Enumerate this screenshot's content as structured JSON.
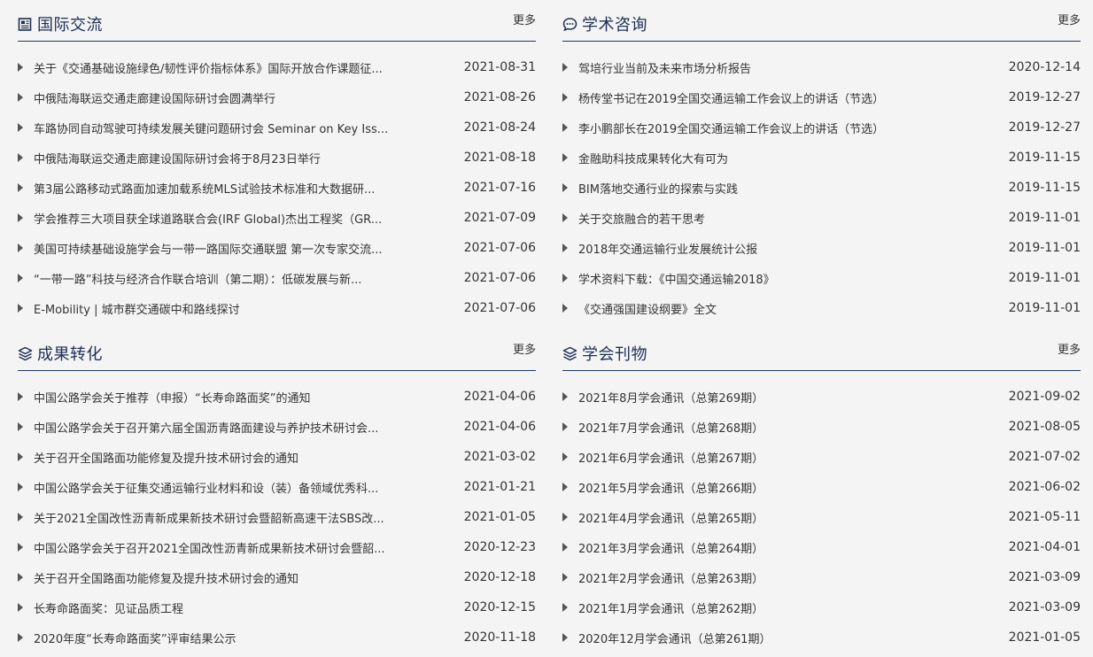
{
  "colors": {
    "accent": "#1e2f55",
    "rule": "#1f3b63",
    "background": "#f4f4f4",
    "text": "#333333"
  },
  "panels": [
    {
      "id": "international",
      "icon": "newspaper-icon",
      "title": "国际交流",
      "more": "更多",
      "items": [
        {
          "title": "关于《交通基础设施绿色/韧性评价指标体系》国际开放合作课题征...",
          "date": "2021-08-31"
        },
        {
          "title": "中俄陆海联运交通走廊建设国际研讨会圆满举行",
          "date": "2021-08-26"
        },
        {
          "title": "车路协同自动驾驶可持续发展关键问题研讨会 Seminar on Key Iss...",
          "date": "2021-08-24"
        },
        {
          "title": "中俄陆海联运交通走廊建设国际研讨会将于8月23日举行",
          "date": "2021-08-18"
        },
        {
          "title": "第3届公路移动式路面加速加载系统MLS试验技术标准和大数据研...",
          "date": "2021-07-16"
        },
        {
          "title": "学会推荐三大项目获全球道路联合会(IRF Global)杰出工程奖（GR...",
          "date": "2021-07-09"
        },
        {
          "title": "美国可持续基础设施学会与一带一路国际交通联盟 第一次专家交流...",
          "date": "2021-07-06"
        },
        {
          "title": "“一带一路”科技与经济合作联合培训（第二期）：低碳发展与新...",
          "date": "2021-07-06"
        },
        {
          "title": "E-Mobility | 城市群交通碳中和路线探讨",
          "date": "2021-07-06"
        }
      ]
    },
    {
      "id": "consulting",
      "icon": "chat-bubble-icon",
      "title": "学术咨询",
      "more": "更多",
      "items": [
        {
          "title": "驾培行业当前及未来市场分析报告",
          "date": "2020-12-14"
        },
        {
          "title": "杨传堂书记在2019全国交通运输工作会议上的讲话（节选）",
          "date": "2019-12-27"
        },
        {
          "title": "李小鹏部长在2019全国交通运输工作会议上的讲话（节选）",
          "date": "2019-12-27"
        },
        {
          "title": "金融助科技成果转化大有可为",
          "date": "2019-11-15"
        },
        {
          "title": "BIM落地交通行业的探索与实践",
          "date": "2019-11-15"
        },
        {
          "title": "关于交旅融合的若干思考",
          "date": "2019-11-01"
        },
        {
          "title": "2018年交通运输行业发展统计公报",
          "date": "2019-11-01"
        },
        {
          "title": "学术资料下载：《中国交通运输2018》",
          "date": "2019-11-01"
        },
        {
          "title": "《交通强国建设纲要》全文",
          "date": "2019-11-01"
        }
      ]
    },
    {
      "id": "achievements",
      "icon": "layers-icon",
      "title": "成果转化",
      "more": "更多",
      "items": [
        {
          "title": "中国公路学会关于推荐（申报）“长寿命路面奖”的通知",
          "date": "2021-04-06"
        },
        {
          "title": "中国公路学会关于召开第六届全国沥青路面建设与养护技术研讨会...",
          "date": "2021-04-06"
        },
        {
          "title": "关于召开全国路面功能修复及提升技术研讨会的通知",
          "date": "2021-03-02"
        },
        {
          "title": "中国公路学会关于征集交通运输行业材料和设（装）备领域优秀科...",
          "date": "2021-01-21"
        },
        {
          "title": "关于2021全国改性沥青新成果新技术研讨会暨韶新高速干法SBS改...",
          "date": "2021-01-05"
        },
        {
          "title": "中国公路学会关于召开2021全国改性沥青新成果新技术研讨会暨韶...",
          "date": "2020-12-23"
        },
        {
          "title": "关于召开全国路面功能修复及提升技术研讨会的通知",
          "date": "2020-12-18"
        },
        {
          "title": "长寿命路面奖：见证品质工程",
          "date": "2020-12-15"
        },
        {
          "title": "2020年度“长寿命路面奖”评审结果公示",
          "date": "2020-11-18"
        }
      ]
    },
    {
      "id": "publications",
      "icon": "layers-icon",
      "title": "学会刊物",
      "more": "更多",
      "items": [
        {
          "title": "2021年8月学会通讯（总第269期）",
          "date": "2021-09-02"
        },
        {
          "title": "2021年7月学会通讯（总第268期）",
          "date": "2021-08-05"
        },
        {
          "title": "2021年6月学会通讯（总第267期）",
          "date": "2021-07-02"
        },
        {
          "title": "2021年5月学会通讯（总第266期）",
          "date": "2021-06-02"
        },
        {
          "title": "2021年4月学会通讯（总第265期）",
          "date": "2021-05-11"
        },
        {
          "title": "2021年3月学会通讯（总第264期）",
          "date": "2021-04-01"
        },
        {
          "title": "2021年2月学会通讯（总第263期）",
          "date": "2021-03-09"
        },
        {
          "title": "2021年1月学会通讯（总第262期）",
          "date": "2021-03-09"
        },
        {
          "title": "2020年12月学会通讯（总第261期）",
          "date": "2021-01-05"
        }
      ]
    }
  ]
}
